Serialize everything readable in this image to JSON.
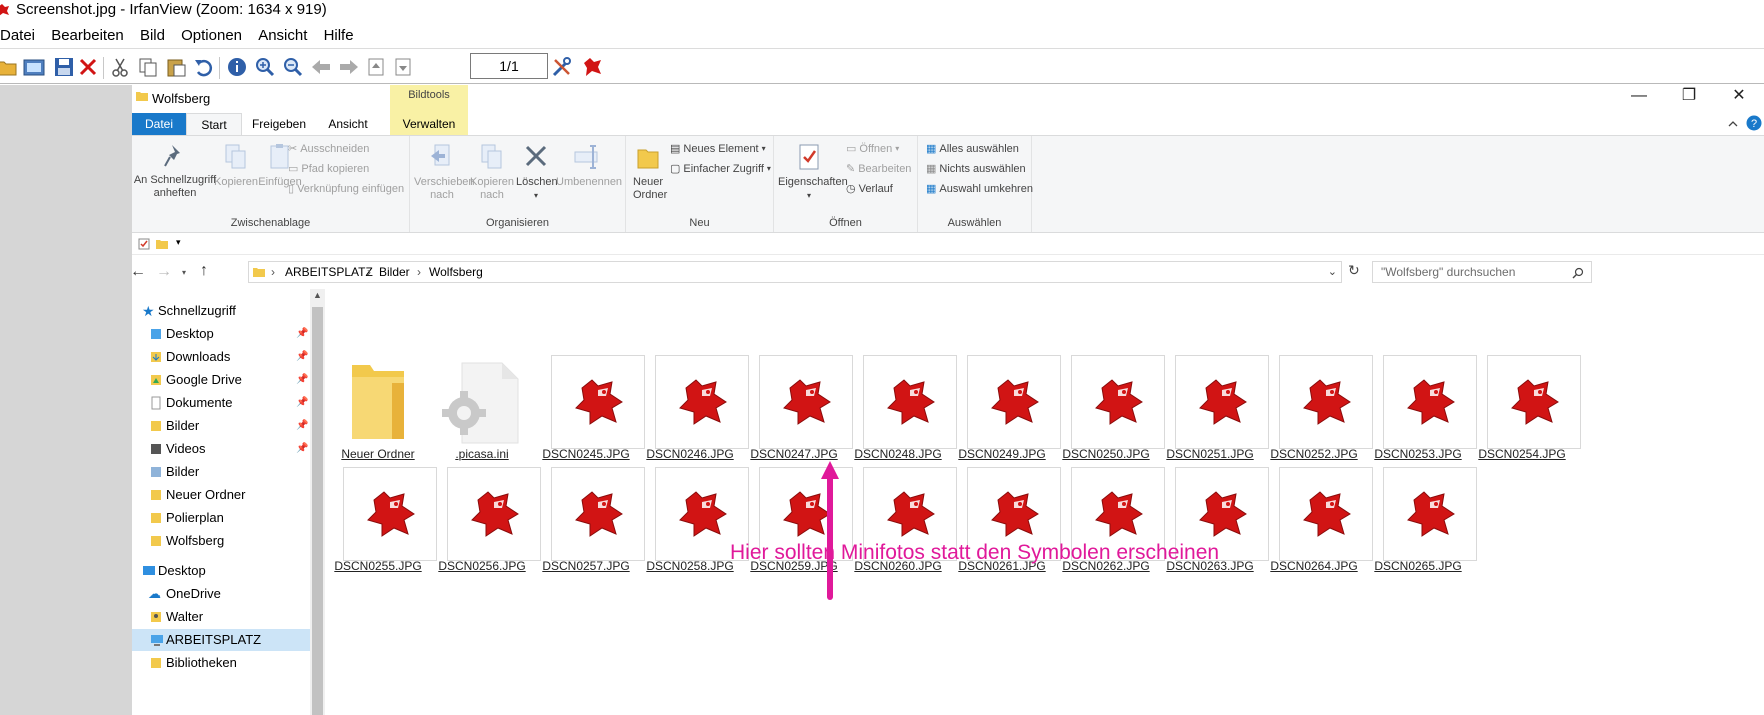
{
  "irfanview": {
    "title": "Screenshot.jpg - IrfanView (Zoom: 1634 x 919)",
    "menu": [
      "Datei",
      "Bearbeiten",
      "Bild",
      "Optionen",
      "Ansicht",
      "Hilfe"
    ],
    "page_indicator": "1/1"
  },
  "explorer": {
    "window_title": "Wolfsberg",
    "context_tab": "Bildtools",
    "tabs": [
      "Datei",
      "Start",
      "Freigeben",
      "Ansicht",
      "Verwalten"
    ],
    "active_tab": "Start",
    "ribbon": {
      "clipboard": {
        "label": "Zwischenablage",
        "pin": "An Schnellzugriff anheften",
        "copy": "Kopieren",
        "paste": "Einfügen",
        "cut": "Ausschneiden",
        "copy_path": "Pfad kopieren",
        "paste_shortcut": "Verknüpfung einfügen"
      },
      "organize": {
        "label": "Organisieren",
        "move": "Verschieben nach",
        "copy_to": "Kopieren nach",
        "delete": "Löschen",
        "rename": "Umbenennen"
      },
      "new": {
        "label": "Neu",
        "new_folder": "Neuer Ordner",
        "new_item": "Neues Element",
        "easy_access": "Einfacher Zugriff"
      },
      "open": {
        "label": "Öffnen",
        "properties": "Eigenschaften",
        "open": "Öffnen",
        "edit": "Bearbeiten",
        "history": "Verlauf"
      },
      "select": {
        "label": "Auswählen",
        "all": "Alles auswählen",
        "none": "Nichts auswählen",
        "invert": "Auswahl umkehren"
      }
    },
    "address": {
      "segments": [
        "ARBEITSPLATZ",
        "Bilder",
        "Wolfsberg"
      ]
    },
    "search": {
      "placeholder": "\"Wolfsberg\" durchsuchen"
    },
    "nav": {
      "quick_access": "Schnellzugriff",
      "quick_items": [
        "Desktop",
        "Downloads",
        "Google Drive",
        "Dokumente",
        "Bilder",
        "Videos"
      ],
      "folders": [
        "Bilder",
        "Neuer Ordner",
        "Polierplan",
        "Wolfsberg"
      ],
      "desktop": "Desktop",
      "desktop_items": [
        "OneDrive",
        "Walter",
        "ARBEITSPLATZ",
        "Bibliotheken"
      ]
    },
    "files_row1": [
      "Neuer Ordner",
      ".picasa.ini",
      "DSCN0245.JPG",
      "DSCN0246.JPG",
      "DSCN0247.JPG",
      "DSCN0248.JPG",
      "DSCN0249.JPG",
      "DSCN0250.JPG",
      "DSCN0251.JPG",
      "DSCN0252.JPG",
      "DSCN0253.JPG",
      "DSCN0254.JPG"
    ],
    "files_row2": [
      "DSCN0255.JPG",
      "DSCN0256.JPG",
      "DSCN0257.JPG",
      "DSCN0258.JPG",
      "DSCN0259.JPG",
      "DSCN0260.JPG",
      "DSCN0261.JPG",
      "DSCN0262.JPG",
      "DSCN0263.JPG",
      "DSCN0264.JPG",
      "DSCN0265.JPG"
    ]
  },
  "annotation": {
    "text": "Hier sollten Minifotos statt den Symbolen erscheinen",
    "color": "#e0199a"
  },
  "colors": {
    "accent": "#1979ca",
    "irfan_red": "#d11414"
  }
}
